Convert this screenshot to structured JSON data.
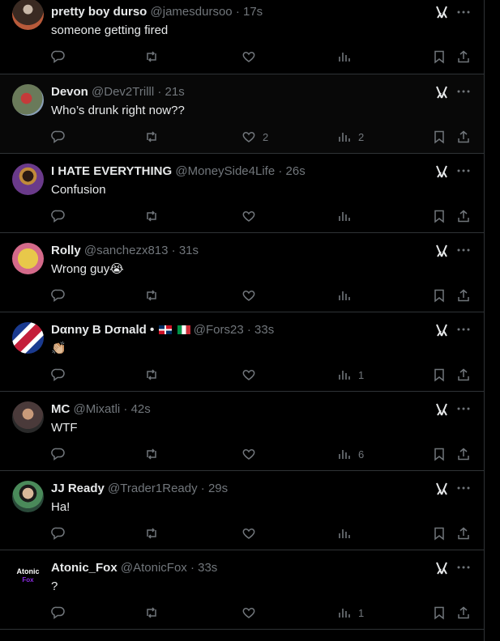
{
  "tweets": [
    {
      "name": "pretty boy durso",
      "handle": "@jamesdursoo",
      "time": "· 17s",
      "text": "someone getting fired",
      "replies": "",
      "reposts": "",
      "likes": "",
      "views": "",
      "avatar_color": "#4a3a30"
    },
    {
      "name": "Devon",
      "handle": "@Dev2Trilll",
      "time": "· 21s",
      "text": "Who’s drunk right now??",
      "replies": "",
      "reposts": "",
      "likes": "2",
      "views": "2",
      "avatar_color": "#5a6a58"
    },
    {
      "name": "I HATE EVERYTHING",
      "handle": "@MoneySide4Life",
      "time": "· 26s",
      "text": "Confusion",
      "replies": "",
      "reposts": "",
      "likes": "",
      "views": "",
      "avatar_color": "#6a3a8a"
    },
    {
      "name": "Rolly",
      "handle": "@sanchezx813",
      "time": "· 31s",
      "text": "Wrong guy😭",
      "replies": "",
      "reposts": "",
      "likes": "",
      "views": "",
      "avatar_color": "#e8c84a"
    },
    {
      "name": "Dαnny B Dσnald •",
      "handle": "@Fors23",
      "time": "· 33s",
      "text": "👏🏼",
      "replies": "",
      "reposts": "",
      "likes": "",
      "views": "1",
      "avatar_color": "#2a3f8f"
    },
    {
      "name": "MC",
      "handle": "@Mixatli",
      "time": "· 42s",
      "text": "WTF",
      "replies": "",
      "reposts": "",
      "likes": "",
      "views": "6",
      "avatar_color": "#8a6a5a"
    },
    {
      "name": "JJ Ready",
      "handle": "@Trader1Ready",
      "time": "· 29s",
      "text": "Ha!",
      "replies": "",
      "reposts": "",
      "likes": "",
      "views": "",
      "avatar_color": "#3a6a4a"
    },
    {
      "name": "Atonic_Fox",
      "handle": "@AtonicFox",
      "time": "· 33s",
      "text": "?",
      "replies": "",
      "reposts": "",
      "likes": "",
      "views": "1",
      "avatar_color": "#000000"
    }
  ],
  "atonic_logo": {
    "line1": "Atonic",
    "line2": "Fox"
  },
  "colors": {
    "background": "#000000",
    "text": "#e7e9ea",
    "muted": "#71767b",
    "border": "#2f3336"
  }
}
